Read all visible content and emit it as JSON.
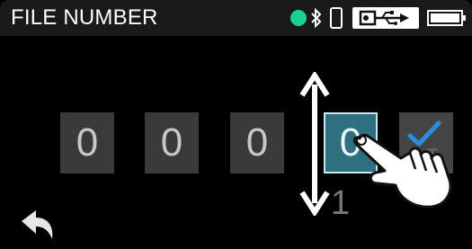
{
  "header": {
    "title": "FILE NUMBER",
    "status_color": "#18d28d",
    "icons": [
      "bluetooth-icon",
      "phone-icon",
      "usb-icon",
      "battery-icon"
    ]
  },
  "digits": [
    "0",
    "0",
    "0",
    "0"
  ],
  "selected_digit_index": 3,
  "next_value_preview": "1",
  "confirm": {
    "icon": "checkmark-icon",
    "sub_label": "T"
  },
  "back": {
    "icon": "back-arrow-icon"
  }
}
